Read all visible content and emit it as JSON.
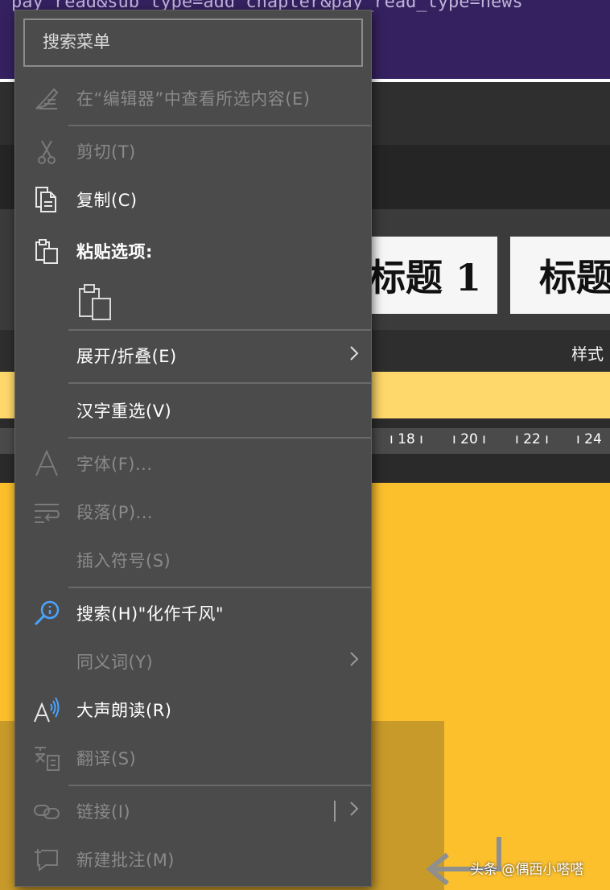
{
  "background": {
    "url_text": "pay_read&sub_type=add_chapter&pay_read_type=news",
    "style_cards": [
      "标题 1",
      "标题"
    ],
    "ribbon_label": "样式",
    "ruler_numbers": [
      "18",
      "20",
      "22",
      "24"
    ],
    "watermark": "头条 @偶西小嗒嗒"
  },
  "menu": {
    "search_placeholder": "搜索菜单",
    "items": [
      {
        "label": "在“编辑器”中查看所选内容(E)",
        "icon": "editor-pen-icon",
        "enabled": false
      },
      {
        "label": "剪切(T)",
        "icon": "scissors-icon",
        "enabled": false
      },
      {
        "label": "复制(C)",
        "icon": "copy-icon",
        "enabled": true
      },
      {
        "label": "粘贴选项:",
        "icon": "paste-icon",
        "enabled": true
      },
      {
        "label": "展开/折叠(E)",
        "icon": "",
        "enabled": true,
        "submenu": true
      },
      {
        "label": "汉字重选(V)",
        "icon": "",
        "enabled": true
      },
      {
        "label": "字体(F)...",
        "icon": "font-icon",
        "enabled": false
      },
      {
        "label": "段落(P)...",
        "icon": "paragraph-icon",
        "enabled": false
      },
      {
        "label": "插入符号(S)",
        "icon": "",
        "enabled": false
      },
      {
        "label": "搜索(H)\"化作千风\"",
        "icon": "search-icon",
        "enabled": true
      },
      {
        "label": "同义词(Y)",
        "icon": "",
        "enabled": false,
        "submenu": true
      },
      {
        "label": "大声朗读(R)",
        "icon": "read-aloud-icon",
        "enabled": true
      },
      {
        "label": "翻译(S)",
        "icon": "translate-icon",
        "enabled": false
      },
      {
        "label": "链接(I)",
        "icon": "link-icon",
        "enabled": false,
        "submenu": true
      },
      {
        "label": "新建批注(M)",
        "icon": "new-comment-icon",
        "enabled": false
      }
    ]
  },
  "colors": {
    "menu_bg": "#4b4b4b",
    "page_bg": "#fcc02d",
    "accent_blue": "#4aa3ff"
  }
}
